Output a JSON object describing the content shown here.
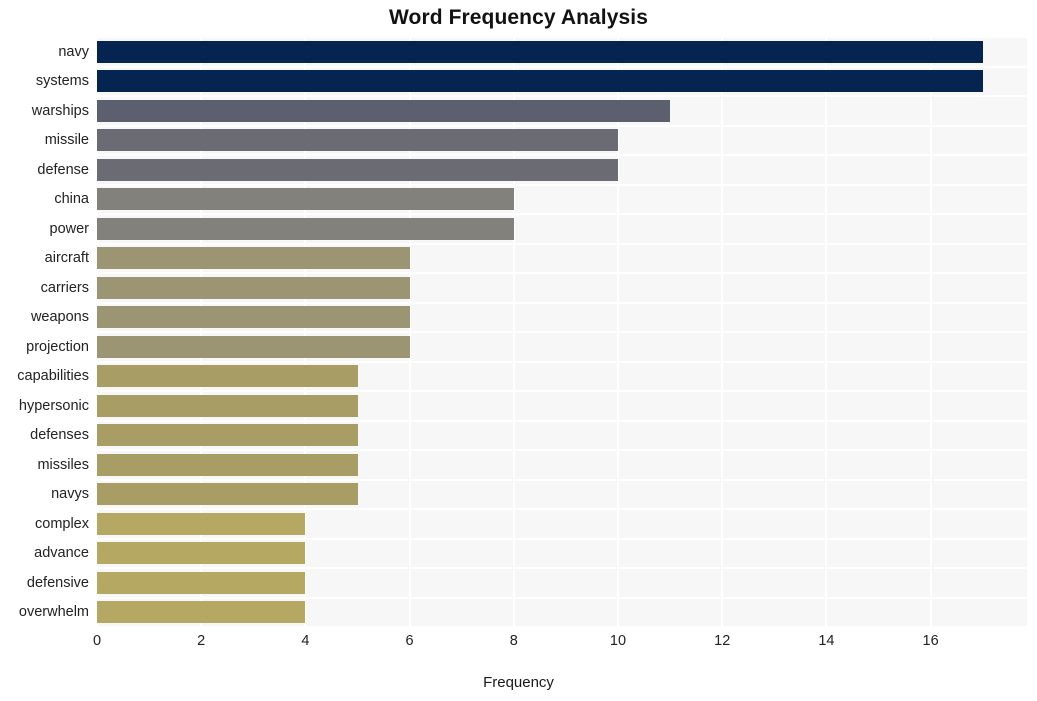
{
  "chart_data": {
    "type": "bar",
    "orientation": "horizontal",
    "title": "Word Frequency Analysis",
    "xlabel": "Frequency",
    "ylabel": "",
    "categories": [
      "navy",
      "systems",
      "warships",
      "missile",
      "defense",
      "china",
      "power",
      "aircraft",
      "carriers",
      "weapons",
      "projection",
      "capabilities",
      "hypersonic",
      "defenses",
      "missiles",
      "navys",
      "complex",
      "advance",
      "defensive",
      "overwhelm"
    ],
    "values": [
      17,
      17,
      11,
      10,
      10,
      8,
      8,
      6,
      6,
      6,
      6,
      5,
      5,
      5,
      5,
      5,
      4,
      4,
      4,
      4
    ],
    "bar_colors": [
      "#05244f",
      "#05244f",
      "#5b5f6e",
      "#6b6b73",
      "#6b6b73",
      "#82817c",
      "#82817c",
      "#9c9573",
      "#9c9573",
      "#9c9573",
      "#9c9573",
      "#a99d66",
      "#a99d66",
      "#a99d66",
      "#a99d66",
      "#a99d66",
      "#b5a862",
      "#b5a862",
      "#b5a862",
      "#b5a862"
    ],
    "xlim": [
      0,
      17.85
    ],
    "xticks": [
      0,
      2,
      4,
      6,
      8,
      10,
      12,
      14,
      16
    ],
    "xtick_labels": [
      "0",
      "2",
      "4",
      "6",
      "8",
      "10",
      "12",
      "14",
      "16"
    ],
    "grid": true,
    "grid_color": "#ffffff",
    "plot_background": "#f7f7f8",
    "figure_background": "#ffffff",
    "legend": null
  }
}
